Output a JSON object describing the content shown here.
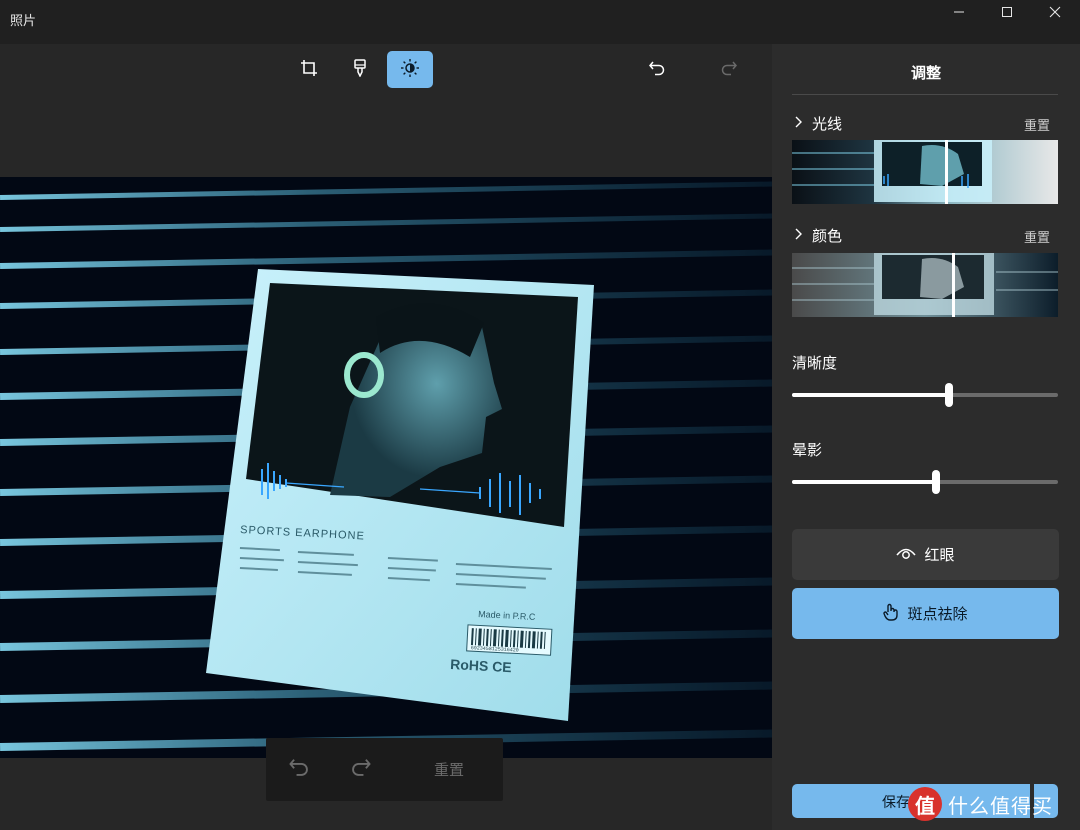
{
  "app": {
    "title": "照片"
  },
  "window_controls": {
    "minimize_icon": "minimize-icon",
    "maximize_icon": "maximize-icon",
    "close_icon": "close-icon"
  },
  "toolbar": {
    "tools": [
      {
        "icon": "crop-icon",
        "active": false
      },
      {
        "icon": "filter-brush-icon",
        "active": false
      },
      {
        "icon": "adjust-brightness-icon",
        "active": true
      }
    ],
    "undo_icon": "undo-icon",
    "redo_icon": "redo-icon"
  },
  "photo": {
    "product_name": "SPORTS EARPHONE",
    "made_in": "Made in P.R.C",
    "barcode_number": "6923458125316420",
    "marks": "RoHS CE"
  },
  "bottom_bar": {
    "undo_icon": "undo-icon",
    "redo_icon": "redo-icon",
    "reset_label": "重置"
  },
  "panel": {
    "title": "调整",
    "sections": [
      {
        "label": "光线",
        "reset": "重置"
      },
      {
        "label": "颜色",
        "reset": "重置"
      }
    ],
    "sliders": [
      {
        "label": "清晰度",
        "value": 0.59
      },
      {
        "label": "晕影",
        "value": 0.54
      }
    ],
    "red_eye_label": "红眼",
    "spot_fix_label": "斑点祛除",
    "save_label": "保存"
  },
  "watermark": {
    "logo": "值",
    "text": "什么值得买"
  },
  "colors": {
    "accent": "#76b9ed",
    "panel_bg": "#2c2c2c",
    "canvas_bg": "#272727",
    "titlebar_bg": "#202020"
  }
}
